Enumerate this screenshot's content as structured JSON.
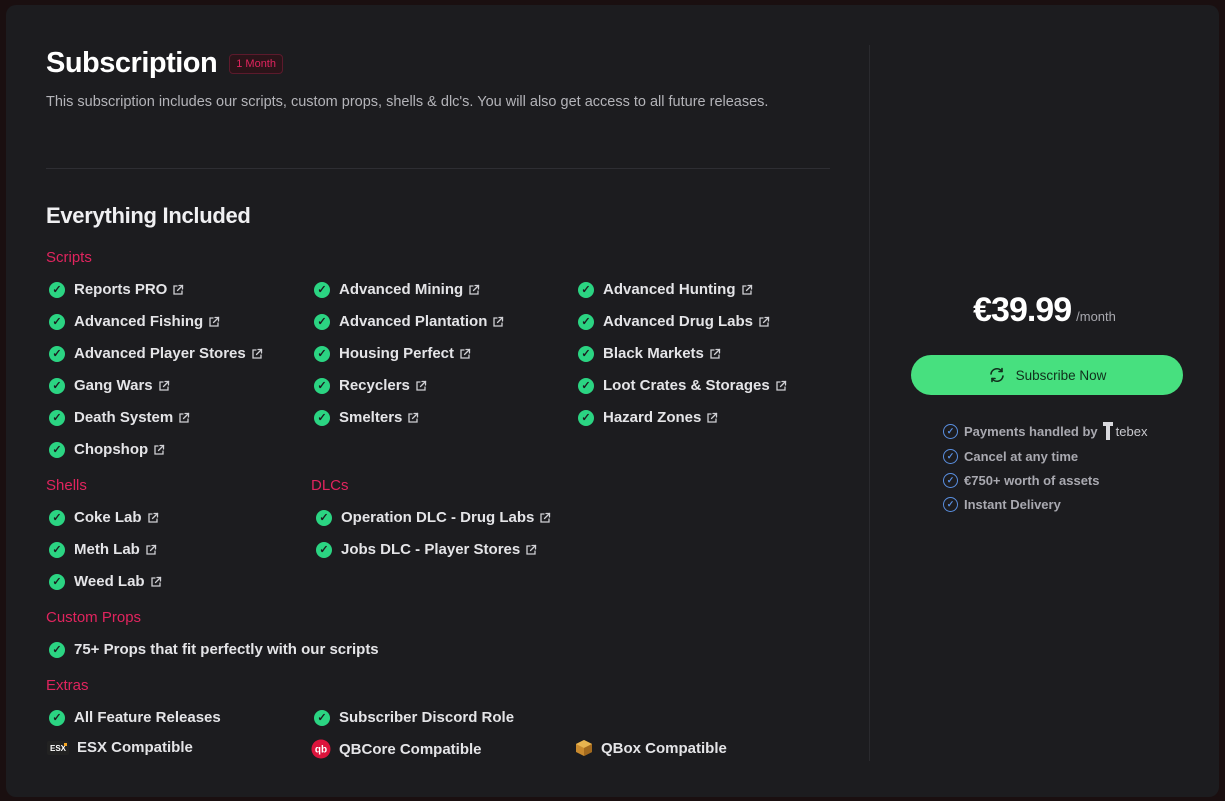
{
  "header": {
    "title": "Subscription",
    "badge": "1 Month",
    "description": "This subscription includes our scripts, custom props, shells & dlc's. You will also get access to all future releases."
  },
  "included": {
    "heading": "Everything Included",
    "scripts_label": "Scripts",
    "scripts": [
      "Reports PRO",
      "Advanced Fishing",
      "Advanced Player Stores",
      "Gang Wars",
      "Death System",
      "Chopshop",
      "Advanced Mining",
      "Advanced Plantation",
      "Housing Perfect",
      "Recyclers",
      "Smelters",
      "Advanced Hunting",
      "Advanced Drug Labs",
      "Black Markets",
      "Loot Crates & Storages",
      "Hazard Zones"
    ],
    "shells_label": "Shells",
    "shells": [
      "Coke Lab",
      "Meth Lab",
      "Weed Lab"
    ],
    "dlcs_label": "DLCs",
    "dlcs": [
      "Operation DLC - Drug Labs",
      "Jobs DLC - Player Stores"
    ],
    "props_label": "Custom Props",
    "props": [
      "75+ Props that fit perfectly with our scripts"
    ],
    "extras_label": "Extras",
    "extras": [
      "All Feature Releases",
      "Subscriber Discord Role"
    ],
    "compat": [
      "ESX Compatible",
      "QBCore Compatible",
      "QBox Compatible"
    ],
    "esx_logo_text": "ESX",
    "qb_logo_text": "qb"
  },
  "pricing": {
    "price": "€39.99",
    "period": "/month",
    "button": "Subscribe Now",
    "features": [
      "Payments handled by",
      "Cancel at any time",
      "€750+ worth of assets",
      "Instant Delivery"
    ],
    "tebex": "tebex"
  },
  "colors": {
    "accent": "#e0245e",
    "check": "#2bd482",
    "button": "#47e07f",
    "card": "#1c1c1f"
  },
  "icons": {
    "check": "check-circle-icon",
    "external": "external-link-icon",
    "refresh": "refresh-icon"
  }
}
